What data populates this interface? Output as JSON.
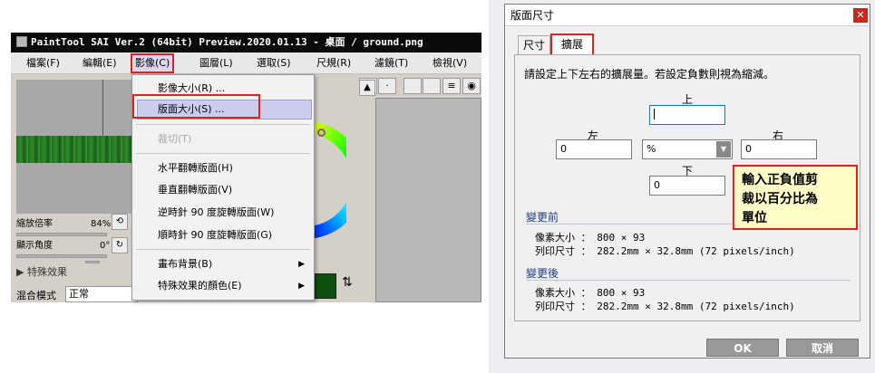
{
  "sai": {
    "title": "PaintTool SAI Ver.2 (64bit) Preview.2020.01.13 - 桌面 / ground.png",
    "menu": [
      "檔案(F)",
      "編輯(E)",
      "影像(C)",
      "圖層(L)",
      "選取(S)",
      "尺規(R)",
      "濾鏡(T)",
      "檢視(V)"
    ],
    "zoom_label": "縮放倍率",
    "zoom_value": "84%",
    "angle_label": "顯示角度",
    "angle_value": "0°",
    "fx_label": "▶ 特殊效果",
    "blend_label": "混合模式",
    "blend_value": "正常",
    "swap_icon": "swap-arrows-icon",
    "swatch_color": "#0d4f0d"
  },
  "image_menu": {
    "items": [
      {
        "label": "影像大小(R) ...",
        "state": "normal"
      },
      {
        "label": "版面大小(S) ...",
        "state": "highlighted"
      },
      {
        "label": "裁切(T)",
        "state": "disabled"
      },
      {
        "label": "水平翻轉版面(H)",
        "state": "normal"
      },
      {
        "label": "垂直翻轉版面(V)",
        "state": "normal"
      },
      {
        "label": "逆時針 90 度旋轉版面(W)",
        "state": "normal"
      },
      {
        "label": "順時針 90 度旋轉版面(G)",
        "state": "normal"
      },
      {
        "label": "畫布背景(B)",
        "state": "submenu"
      },
      {
        "label": "特殊效果的顏色(E)",
        "state": "submenu"
      }
    ]
  },
  "dialog": {
    "title": "版面尺寸",
    "tabs": [
      "尺寸",
      "擴展"
    ],
    "active_tab": "擴展",
    "instruction": "請設定上下左右的擴展量。若設定負數則視為縮減。",
    "labels": {
      "top": "上",
      "left": "左",
      "right": "右",
      "bottom": "下"
    },
    "values": {
      "top": "",
      "left": "0",
      "right": "0",
      "bottom": "0"
    },
    "unit": "%",
    "note": "輸入正負值剪\n裁以百分比為\n單位",
    "before": {
      "title": "變更前",
      "pixel_label": "像素大小 ：",
      "pixel_value": "800 × 93",
      "print_label": "列印尺寸 ：",
      "print_value": "282.2mm × 32.8mm (72 pixels/inch)"
    },
    "after": {
      "title": "變更後",
      "pixel_label": "像素大小 ：",
      "pixel_value": "800 × 93",
      "print_label": "列印尺寸 ：",
      "print_value": "282.2mm × 32.8mm (72 pixels/inch)"
    },
    "ok_label": "OK",
    "cancel_label": "取消",
    "close_icon": "close-icon"
  }
}
